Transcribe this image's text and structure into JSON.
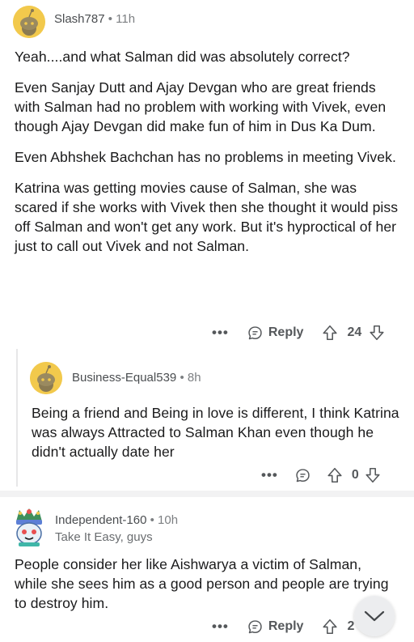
{
  "comments": [
    {
      "username": "Slash787",
      "separator": "•",
      "timestamp": "11h",
      "paragraphs": [
        "Yeah....and what Salman did was absolutely correct?",
        "Even Sanjay Dutt and Ajay Devgan who are great friends with Salman had no problem with working with Vivek, even though Ajay Devgan did make fun of him in Dus Ka Dum.",
        "Even Abhshek Bachchan has no problems in meeting Vivek.",
        "Katrina was getting movies cause of Salman, she was scared if she works with Vivek then she thought it would piss off Salman and won't get any work. But it's hyproctical of her just to call out Vivek and not Salman."
      ],
      "more": "•••",
      "reply_label": "Reply",
      "score": "24"
    },
    {
      "username": "Business-Equal539",
      "separator": "•",
      "timestamp": "8h",
      "paragraphs": [
        "Being a friend and Being in love is different, I think Katrina was always Attracted to Salman Khan even though he didn't actually date her"
      ],
      "more": "•••",
      "score": "0"
    },
    {
      "username": "Independent-160",
      "separator": "•",
      "timestamp": "10h",
      "flair": "Take It Easy, guys",
      "paragraphs": [
        "People consider her like Aishwarya a victim of Salman, while she sees him as a good person and people are trying to destroy him."
      ],
      "more": "•••",
      "reply_label": "Reply",
      "score": "2"
    }
  ],
  "colors": {
    "snoo_yellow": "#f2c94c",
    "text": "#1a1a1b",
    "meta": "#7c7f82",
    "icon": "#55585b"
  },
  "icons": [
    "more-icon",
    "reply-icon",
    "upvote-icon",
    "downvote-icon",
    "chevron-down-icon"
  ]
}
